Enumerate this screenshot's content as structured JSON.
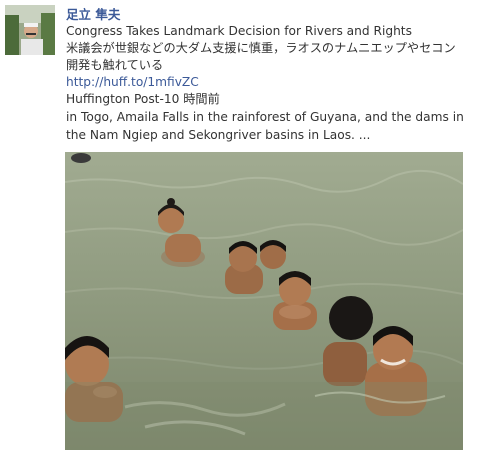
{
  "post": {
    "author": "足立 隼夫",
    "headline": "Congress Takes Landmark Decision for Rivers and Rights",
    "japanese_line1": "米議会が世銀などの大ダム支援に慎重，ラオスのナムニエップやセコン",
    "japanese_line2": "開発も触れている",
    "link": "http://huff.to/1mfivZC",
    "source": "Huffington Post-10 時間前",
    "description": "in Togo, Amaila Falls in the rainforest of Guyana, and the dams in the Nam Ngiep and Sekongriver basins in Laos. ..."
  },
  "colors": {
    "link": "#3b5998",
    "text": "#333333",
    "water": "#8a9a7c"
  }
}
